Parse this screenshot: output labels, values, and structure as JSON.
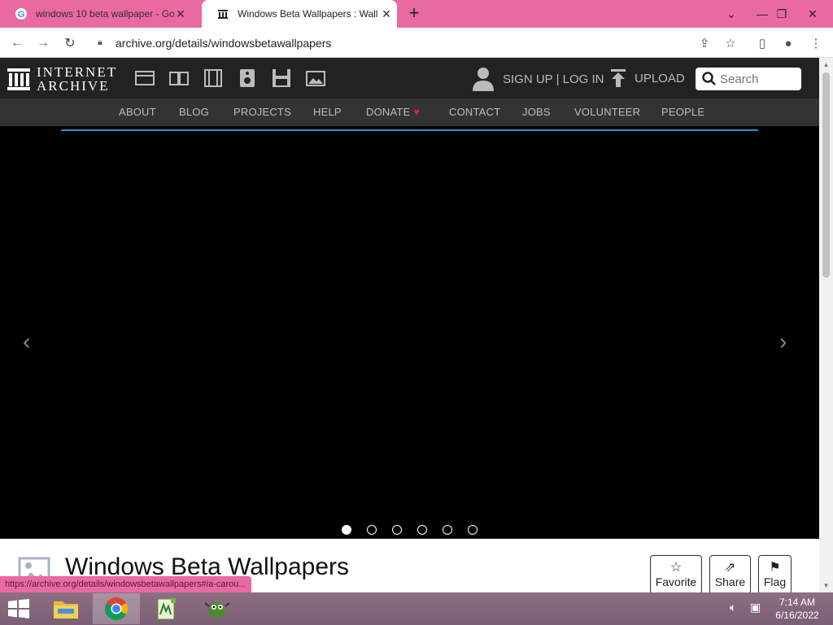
{
  "browser": {
    "tabs": [
      {
        "title": "windows 10 beta wallpaper - Go",
        "active": false
      },
      {
        "title": "Windows Beta Wallpapers : Wall",
        "active": true
      }
    ],
    "new_tab": "+",
    "url_value": "archive.org/details/windowsbetawallpapers"
  },
  "ia": {
    "logo_line1": "INTERNET",
    "logo_line2": "ARCHIVE",
    "signup": "SIGN UP | LOG IN",
    "upload": "UPLOAD",
    "search_placeholder": "Search",
    "nav": [
      "ABOUT",
      "BLOG",
      "PROJECTS",
      "HELP",
      "DONATE",
      "CONTACT",
      "JOBS",
      "VOLUNTEER",
      "PEOPLE"
    ],
    "donate_heart_color": "#e02020"
  },
  "carousel": {
    "dot_count": 6,
    "active_dot": 1,
    "accent": "#2a8fd6"
  },
  "item": {
    "title": "Windows Beta Wallpapers",
    "actions": [
      "Favorite",
      "Share",
      "Flag"
    ]
  },
  "status_url": "https://archive.org/details/windowsbetawallpapers#ia-carou...",
  "taskbar": {
    "time": "7:14 AM",
    "date": "6/16/2022"
  }
}
